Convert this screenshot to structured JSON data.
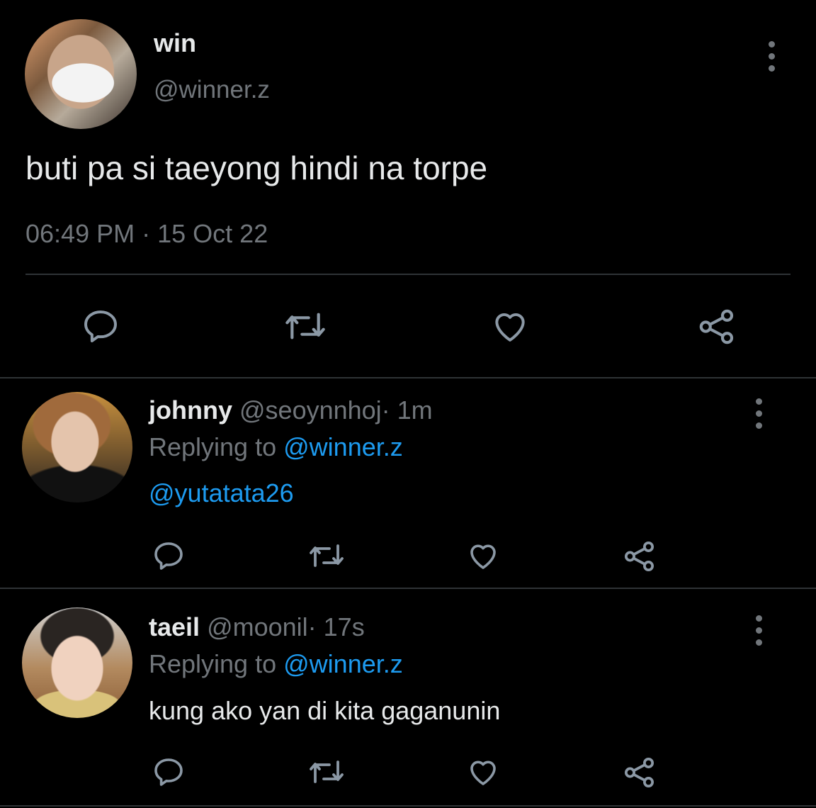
{
  "main_tweet": {
    "display_name": "win",
    "handle": "@winner.z",
    "text": "buti pa si taeyong hindi na torpe",
    "time": "06:49 PM",
    "separator": "·",
    "date": "15 Oct 22",
    "avatar_icon": "user-avatar",
    "actions": [
      "reply-icon",
      "retweet-icon",
      "like-icon",
      "share-icon"
    ]
  },
  "replies": [
    {
      "display_name": "johnny",
      "handle": "@seoynnhoj",
      "time": "· 1m",
      "replying_prefix": "Replying to",
      "replying_handle": "@winner.z",
      "text": "@yutatata26",
      "text_is_mention": true
    },
    {
      "display_name": "taeil",
      "handle": "@moonil",
      "time": "· 17s",
      "replying_prefix": "Replying to",
      "replying_handle": "@winner.z",
      "text": "kung ako yan di kita gaganunin",
      "text_is_mention": false
    }
  ],
  "colors": {
    "background": "#000000",
    "text": "#e7e9ea",
    "muted": "#71767b",
    "link": "#1d9bf0",
    "divider": "#2f3336"
  }
}
